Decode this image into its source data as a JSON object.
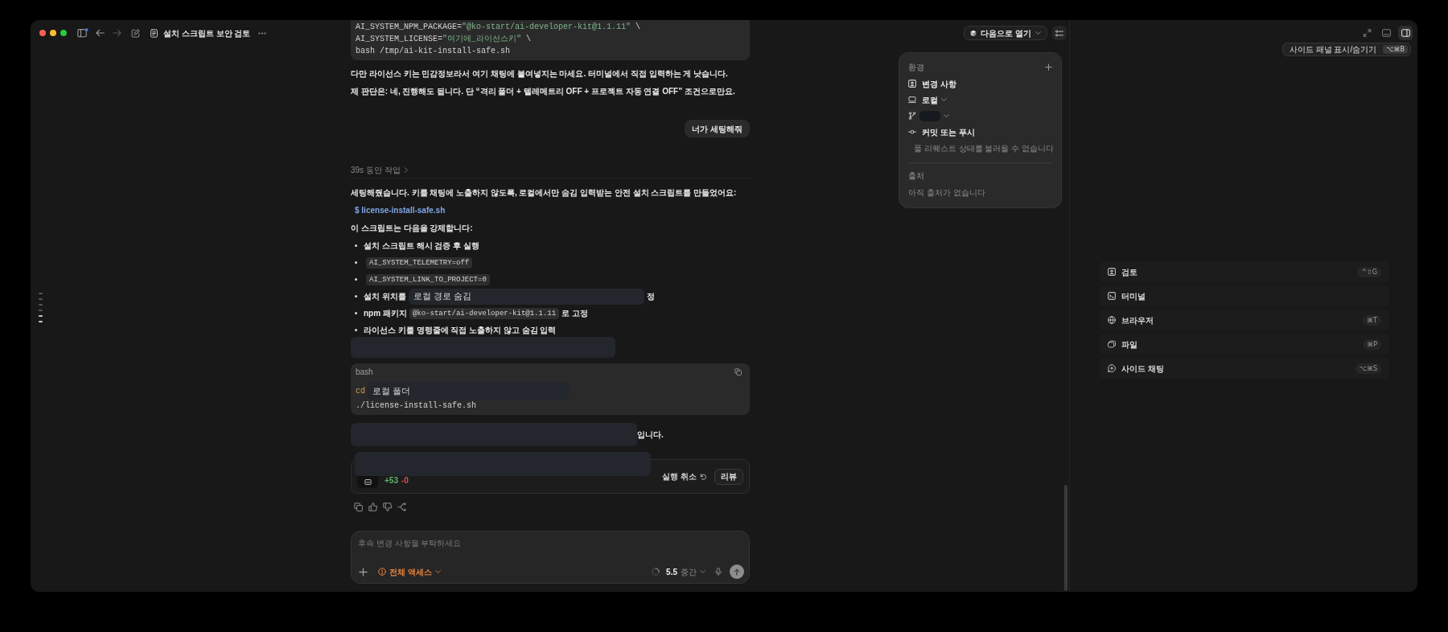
{
  "window": {
    "title": "설치 스크립트 보안 검토"
  },
  "turn_markers": [
    {
      "selected": false
    },
    {
      "selected": false
    },
    {
      "selected": false
    },
    {
      "selected": false
    },
    {
      "selected": true
    },
    {
      "selected": true
    }
  ],
  "conversation": [
    {
      "kind": "code",
      "lines": [
        [
          {
            "kind": "plain",
            "text": "AI_SYSTEM_NPM_PACKAGE="
          },
          {
            "kind": "string",
            "text": "\"@ko-start/ai-developer-kit@1.1.11\""
          },
          {
            "kind": "plain",
            "text": " \\"
          }
        ],
        [
          {
            "kind": "plain",
            "text": "AI_SYSTEM_LICENSE="
          },
          {
            "kind": "string",
            "text": "\"여기에_라이선스키\""
          },
          {
            "kind": "plain",
            "text": " \\"
          }
        ],
        [
          {
            "kind": "plain",
            "text": "bash /tmp/ai-kit-install-safe.sh"
          }
        ]
      ]
    },
    {
      "kind": "paragraph",
      "text": "다만 라이선스 키는 민감정보라서 여기 채팅에 붙여넣지는 마세요. 터미널에서 직접 입력하는 게 낫습니다."
    },
    {
      "kind": "paragraph",
      "text": "제 판단은: 네, 진행해도 됩니다. 단 “격리 폴더 + 텔레메트리 OFF + 프로젝트 자동 연결 OFF” 조건으로만요."
    },
    {
      "kind": "user_message",
      "text": "너가 세팅해줘"
    },
    {
      "kind": "work_summary",
      "text": "39s 동안 작업"
    },
    {
      "kind": "paragraph",
      "text": "세팅해줬습니다. 키를 채팅에 노출하지 않도록, 로컬에서만 숨김 입력받는 안전 설치 스크립트를 만들었어요:"
    },
    {
      "kind": "file_link",
      "prefix": "$",
      "text": "license-install-safe.sh"
    },
    {
      "kind": "paragraph",
      "text": "이 스크립트는 다음을 강제합니다:"
    },
    {
      "kind": "list",
      "items": [
        [
          {
            "kind": "text",
            "text": "설치 스크립트 해시 검증 후 실행"
          }
        ],
        [
          {
            "kind": "code",
            "text": "AI_SYSTEM_TELEMETRY=off"
          }
        ],
        [
          {
            "kind": "code",
            "text": "AI_SYSTEM_LINK_TO_PROJECT=0"
          }
        ],
        [
          {
            "kind": "text",
            "text": "설치 위치를"
          },
          {
            "kind": "redaction",
            "text": "로컬 경로 숨김"
          },
          {
            "kind": "text",
            "text": "정"
          }
        ],
        [
          {
            "kind": "text",
            "text": "npm 패키지"
          },
          {
            "kind": "code",
            "text": "@ko-start/ai-developer-kit@1.1.11"
          },
          {
            "kind": "text",
            "text": "로 고정"
          }
        ],
        [
          {
            "kind": "text",
            "text": "라이선스 키를 명령줄에 직접 노출하지 않고 숨김 입력"
          }
        ]
      ]
    },
    {
      "kind": "redaction"
    },
    {
      "kind": "code",
      "language": "bash",
      "lines": [
        [
          {
            "kind": "keyword",
            "text": "cd"
          },
          {
            "kind": "redaction",
            "text": "로컬 폴더"
          }
        ],
        [
          {
            "kind": "plain",
            "text": "./license-install-safe.sh"
          }
        ]
      ]
    },
    {
      "kind": "line",
      "segments": [
        {
          "kind": "redaction"
        },
        {
          "kind": "text",
          "text": "입니다."
        }
      ]
    },
    {
      "kind": "change_card",
      "added": "+53",
      "removed": "-0",
      "undo": "실행 취소",
      "review": "리뷰",
      "redacted": true
    }
  ],
  "composer": {
    "placeholder": "후속 변경 사항을 부탁하세요",
    "access": "전체 액세스",
    "model": "5.5",
    "effort": "중간"
  },
  "toolbar": {
    "open_with": "다음으로 열기"
  },
  "environment": {
    "title": "환경",
    "items": [
      {
        "kind": "changes",
        "label": "변경 사항"
      },
      {
        "kind": "location",
        "label": "로컬"
      },
      {
        "kind": "branch"
      },
      {
        "kind": "commit",
        "label": "커밋 또는 푸시"
      },
      {
        "kind": "pull_request",
        "label": "풀 리퀘스트 상태를 불러올 수 없습니다"
      }
    ],
    "sources_title": "출처",
    "sources_empty": "아직 출처가 없습니다"
  },
  "panel_buttons": [
    {
      "selected": false
    },
    {
      "selected": false
    },
    {
      "selected": true
    }
  ],
  "tooltip": {
    "text": "사이드 패널 표시/숨기기",
    "shortcut": "⌥⌘B"
  },
  "side_panel": {
    "items": [
      {
        "kind": "review",
        "label": "검토",
        "shortcut": "^⇧G"
      },
      {
        "kind": "terminal",
        "label": "터미널"
      },
      {
        "kind": "browser",
        "label": "브라우저",
        "shortcut": "⌘T"
      },
      {
        "kind": "files",
        "label": "파일",
        "shortcut": "⌘P"
      },
      {
        "kind": "side_chat",
        "label": "사이드 채팅",
        "shortcut": "⌥⌘S"
      }
    ]
  }
}
